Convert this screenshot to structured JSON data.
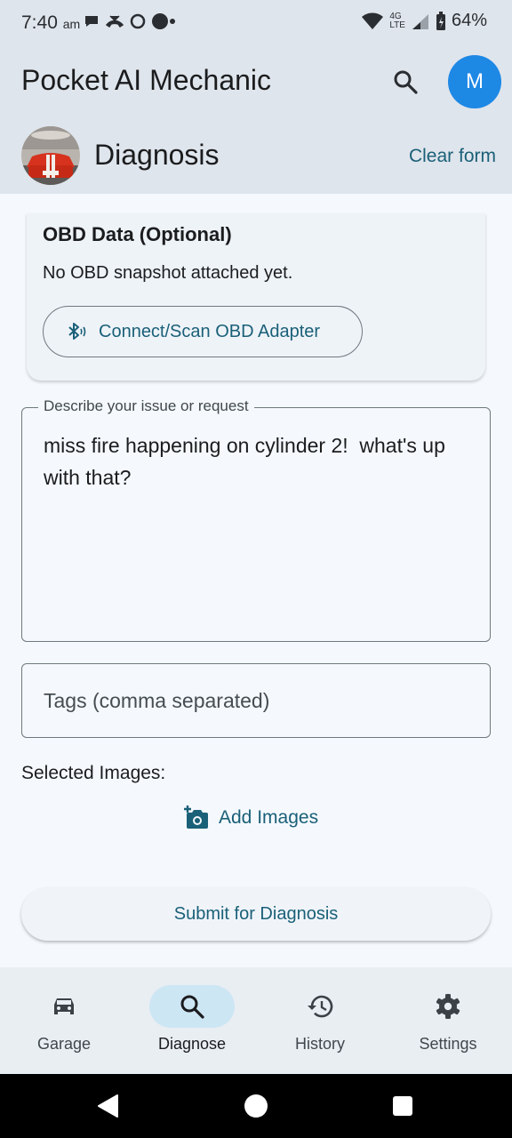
{
  "status_bar": {
    "time": "7:40",
    "am_pm": "am",
    "network": "4G",
    "lte": "LTE",
    "battery": "64%"
  },
  "app_bar": {
    "title": "Pocket AI Mechanic",
    "avatar_letter": "M",
    "section_title": "Diagnosis",
    "clear_label": "Clear form"
  },
  "obd": {
    "title": "OBD Data (Optional)",
    "status": "No OBD snapshot attached yet.",
    "connect_label": "Connect/Scan OBD Adapter"
  },
  "description": {
    "label": "Describe your issue or request",
    "value": "miss fire happening on cylinder 2!  what's up with that?"
  },
  "tags": {
    "placeholder": "Tags (comma separated)"
  },
  "images": {
    "label": "Selected Images:",
    "add_label": "Add Images"
  },
  "submit": {
    "label": "Submit for Diagnosis"
  },
  "nav": {
    "items": [
      {
        "label": "Garage",
        "icon": "car-icon"
      },
      {
        "label": "Diagnose",
        "icon": "search-icon"
      },
      {
        "label": "History",
        "icon": "history-icon"
      },
      {
        "label": "Settings",
        "icon": "gear-icon"
      }
    ],
    "active_index": 1
  },
  "colors": {
    "accent": "#1a6078",
    "avatar": "#1e88e5",
    "active_pill": "#cde6f4"
  }
}
